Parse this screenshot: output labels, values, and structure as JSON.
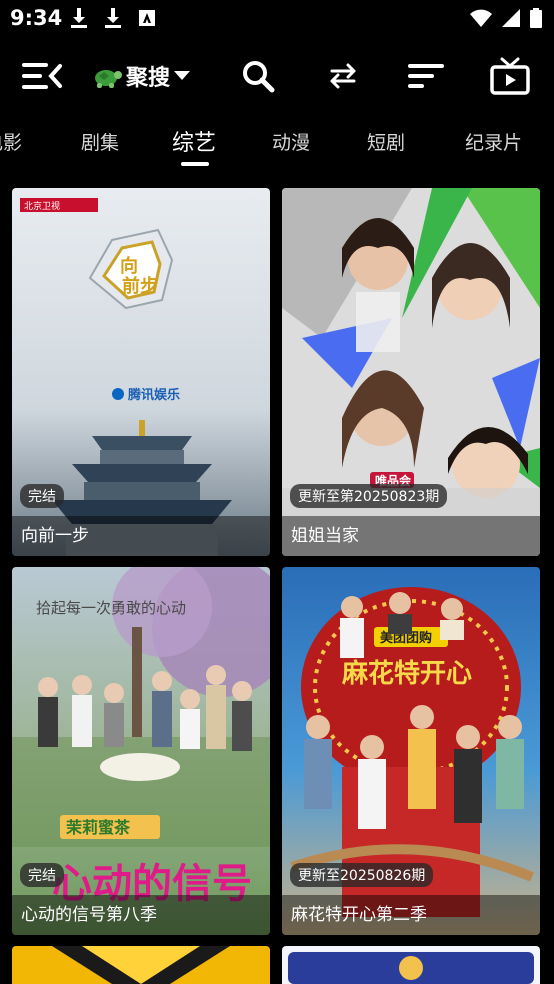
{
  "status_bar": {
    "time": "9:34"
  },
  "toolbar": {
    "source_name": "聚搜"
  },
  "tabs": [
    {
      "label": "电影"
    },
    {
      "label": "剧集"
    },
    {
      "label": "综艺"
    },
    {
      "label": "动漫"
    },
    {
      "label": "短剧"
    },
    {
      "label": "纪录片"
    }
  ],
  "active_tab": "综艺",
  "cards": [
    {
      "title": "向前一步",
      "badge": "完结",
      "logo_text": "腾讯娱乐",
      "channel_text": "北京卫视"
    },
    {
      "title": "姐姐当家",
      "badge": "更新至第20250823期",
      "logo_text": "唯品会"
    },
    {
      "title": "心动的信号第八季",
      "badge": "完结",
      "poster_text": "心动的信号",
      "slogan_text": "拾起每一次勇敢的心动",
      "sponsor_text": "茉莉蜜茶"
    },
    {
      "title": "麻花特开心第二季",
      "badge": "更新至20250826期",
      "poster_text": "麻花特开心",
      "sponsor_text": "美团团购"
    }
  ]
}
